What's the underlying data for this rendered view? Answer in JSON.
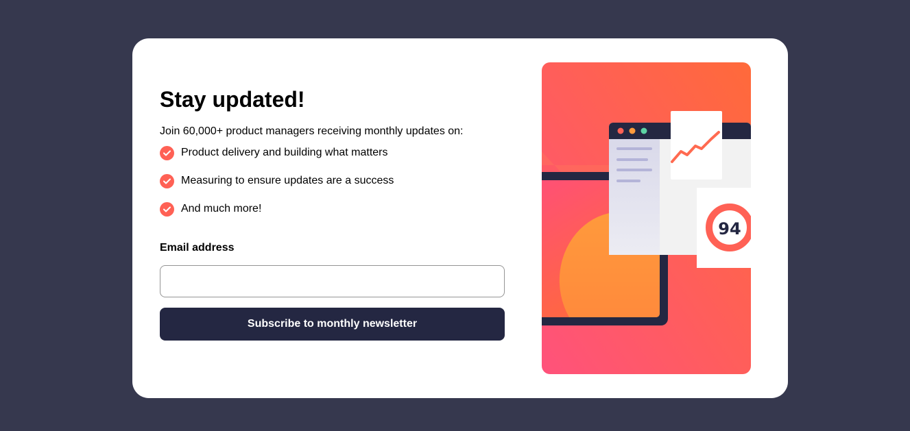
{
  "title": "Stay updated!",
  "intro": "Join 60,000+ product managers receiving monthly updates on:",
  "features": [
    "Product delivery and building what matters",
    "Measuring to ensure updates are a success",
    "And much more!"
  ],
  "form": {
    "email_label": "Email address",
    "email_value": "",
    "email_placeholder": "",
    "submit_label": "Subscribe to monthly newsletter"
  },
  "illustration": {
    "score": "94"
  },
  "colors": {
    "page_background": "#36384e",
    "card_background": "#ffffff",
    "accent": "#ff6155",
    "button": "#242742"
  },
  "icons": {
    "feature_check": "checkmark-icon"
  }
}
